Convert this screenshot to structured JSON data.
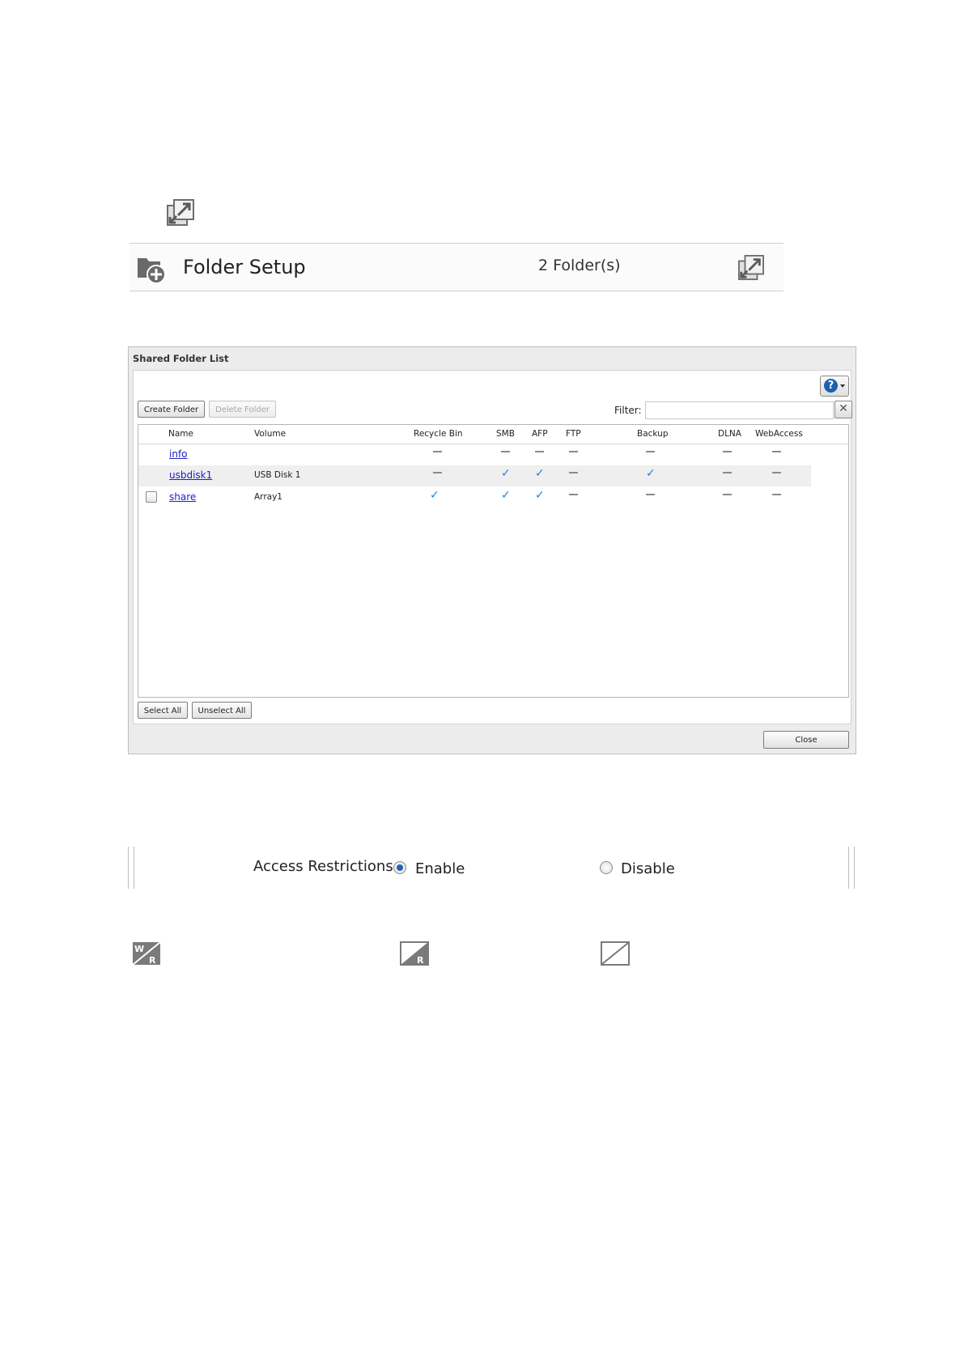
{
  "setup_bar": {
    "title": "Folder Setup",
    "count": "2 Folder(s)"
  },
  "dialog": {
    "title": "Shared Folder List",
    "help_icon": "question-icon",
    "buttons": {
      "create": "Create Folder",
      "delete": "Delete Folder",
      "select_all": "Select All",
      "unselect_all": "Unselect All",
      "close": "Close"
    },
    "filter": {
      "label": "Filter:",
      "value": "",
      "clear": "✕"
    },
    "columns": [
      "Name",
      "Volume",
      "Recycle Bin",
      "SMB",
      "AFP",
      "FTP",
      "Backup",
      "DLNA",
      "WebAccess"
    ],
    "rows": [
      {
        "name": "info",
        "volume": "",
        "recycle_bin": false,
        "smb": false,
        "afp": false,
        "ftp": false,
        "backup": false,
        "dlna": false,
        "webaccess": false,
        "has_checkbox": false
      },
      {
        "name": "usbdisk1",
        "volume": "USB Disk 1",
        "recycle_bin": false,
        "smb": true,
        "afp": true,
        "ftp": false,
        "backup": true,
        "dlna": false,
        "webaccess": false,
        "has_checkbox": false
      },
      {
        "name": "share",
        "volume": "Array1",
        "recycle_bin": true,
        "smb": true,
        "afp": true,
        "ftp": false,
        "backup": false,
        "dlna": false,
        "webaccess": false,
        "has_checkbox": true
      }
    ]
  },
  "access_restrictions": {
    "label": "Access Restrictions:",
    "options": [
      {
        "label": "Enable",
        "selected": true
      },
      {
        "label": "Disable",
        "selected": false
      }
    ]
  },
  "icons": {
    "expand": "expand-icon",
    "folder_add": "folder-add-icon",
    "permissions": [
      "read-write-icon",
      "read-only-icon",
      "no-access-icon"
    ]
  },
  "colors": {
    "link": "#2020c8",
    "check": "#1b7fe0",
    "radio_selected": "#1f63b8"
  }
}
